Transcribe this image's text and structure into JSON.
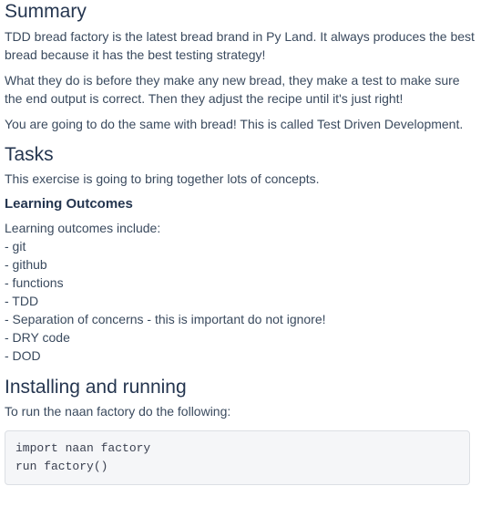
{
  "summary": {
    "title": "Summary",
    "paragraphs": [
      "TDD bread factory is the latest bread brand in Py Land. It always produces the best bread because it has the best testing strategy!",
      "What they do is before they make any new bread, they make a test to make sure the end output is correct. Then they adjust the recipe until it's just right!",
      "You are going to do the same with bread! This is called Test Driven Development."
    ]
  },
  "tasks": {
    "title": "Tasks",
    "intro": "This exercise is going to bring together lots of concepts."
  },
  "learning_outcomes": {
    "title": "Learning Outcomes",
    "intro": "Learning outcomes include:",
    "items": [
      "- git",
      "- github",
      "- functions",
      "- TDD",
      "- Separation of concerns - this is important do not ignore!",
      "- DRY code",
      "- DOD"
    ]
  },
  "installing": {
    "title": "Installing and running",
    "intro": "To run the naan factory do the following:",
    "code": [
      "import naan factory",
      "run factory()"
    ]
  }
}
